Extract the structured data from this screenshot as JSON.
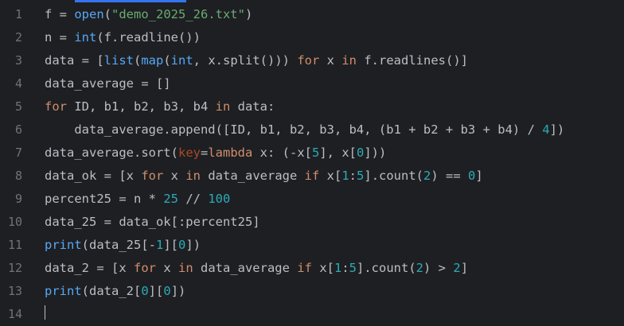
{
  "editor": {
    "colors": {
      "background": "#1e1f22",
      "line_number": "#6f737a",
      "default": "#bcbec4",
      "keyword": "#cf8e6d",
      "builtin": "#56a8f5",
      "string": "#6aab73",
      "number": "#2aacb8",
      "param": "#aa4926"
    },
    "lines": [
      {
        "number": "1",
        "tokens": [
          {
            "t": "f = ",
            "c": "default"
          },
          {
            "t": "open",
            "c": "builtin"
          },
          {
            "t": "(",
            "c": "default"
          },
          {
            "t": "\"demo_2025_26.txt\"",
            "c": "string"
          },
          {
            "t": ")",
            "c": "default"
          }
        ]
      },
      {
        "number": "2",
        "tokens": [
          {
            "t": "n = ",
            "c": "default"
          },
          {
            "t": "int",
            "c": "builtin"
          },
          {
            "t": "(f.readline())",
            "c": "default"
          }
        ]
      },
      {
        "number": "3",
        "tokens": [
          {
            "t": "data = [",
            "c": "default"
          },
          {
            "t": "list",
            "c": "builtin"
          },
          {
            "t": "(",
            "c": "default"
          },
          {
            "t": "map",
            "c": "builtin"
          },
          {
            "t": "(",
            "c": "default"
          },
          {
            "t": "int",
            "c": "builtin"
          },
          {
            "t": ", x.split())) ",
            "c": "default"
          },
          {
            "t": "for",
            "c": "keyword"
          },
          {
            "t": " x ",
            "c": "default"
          },
          {
            "t": "in",
            "c": "keyword"
          },
          {
            "t": " f.readlines()]",
            "c": "default"
          }
        ]
      },
      {
        "number": "4",
        "tokens": [
          {
            "t": "data_average = []",
            "c": "default"
          }
        ]
      },
      {
        "number": "5",
        "tokens": [
          {
            "t": "for",
            "c": "keyword"
          },
          {
            "t": " ID, b1, b2, b3, b4 ",
            "c": "default"
          },
          {
            "t": "in",
            "c": "keyword"
          },
          {
            "t": " data:",
            "c": "default"
          }
        ]
      },
      {
        "number": "6",
        "tokens": [
          {
            "t": "    data_average.append([ID, b1, b2, b3, b4, (b1 + b2 + b3 + b4) / ",
            "c": "default"
          },
          {
            "t": "4",
            "c": "number"
          },
          {
            "t": "])",
            "c": "default"
          }
        ]
      },
      {
        "number": "7",
        "tokens": [
          {
            "t": "data_average.sort(",
            "c": "default"
          },
          {
            "t": "key",
            "c": "param"
          },
          {
            "t": "=",
            "c": "default"
          },
          {
            "t": "lambda",
            "c": "keyword"
          },
          {
            "t": " x: (-x[",
            "c": "default"
          },
          {
            "t": "5",
            "c": "number"
          },
          {
            "t": "], x[",
            "c": "default"
          },
          {
            "t": "0",
            "c": "number"
          },
          {
            "t": "]))",
            "c": "default"
          }
        ]
      },
      {
        "number": "8",
        "tokens": [
          {
            "t": "data_ok = [x ",
            "c": "default"
          },
          {
            "t": "for",
            "c": "keyword"
          },
          {
            "t": " x ",
            "c": "default"
          },
          {
            "t": "in",
            "c": "keyword"
          },
          {
            "t": " data_average ",
            "c": "default"
          },
          {
            "t": "if",
            "c": "keyword"
          },
          {
            "t": " x[",
            "c": "default"
          },
          {
            "t": "1",
            "c": "number"
          },
          {
            "t": ":",
            "c": "default"
          },
          {
            "t": "5",
            "c": "number"
          },
          {
            "t": "].count(",
            "c": "default"
          },
          {
            "t": "2",
            "c": "number"
          },
          {
            "t": ") == ",
            "c": "default"
          },
          {
            "t": "0",
            "c": "number"
          },
          {
            "t": "]",
            "c": "default"
          }
        ]
      },
      {
        "number": "9",
        "tokens": [
          {
            "t": "percent25 = n * ",
            "c": "default"
          },
          {
            "t": "25",
            "c": "number"
          },
          {
            "t": " // ",
            "c": "default"
          },
          {
            "t": "100",
            "c": "number"
          }
        ]
      },
      {
        "number": "10",
        "tokens": [
          {
            "t": "data_25 = data_ok[:percent25]",
            "c": "default"
          }
        ]
      },
      {
        "number": "11",
        "tokens": [
          {
            "t": "print",
            "c": "builtin"
          },
          {
            "t": "(data_25[-",
            "c": "default"
          },
          {
            "t": "1",
            "c": "number"
          },
          {
            "t": "][",
            "c": "default"
          },
          {
            "t": "0",
            "c": "number"
          },
          {
            "t": "])",
            "c": "default"
          }
        ]
      },
      {
        "number": "12",
        "tokens": [
          {
            "t": "data_2 = [x ",
            "c": "default"
          },
          {
            "t": "for",
            "c": "keyword"
          },
          {
            "t": " x ",
            "c": "default"
          },
          {
            "t": "in",
            "c": "keyword"
          },
          {
            "t": " data_average ",
            "c": "default"
          },
          {
            "t": "if",
            "c": "keyword"
          },
          {
            "t": " x[",
            "c": "default"
          },
          {
            "t": "1",
            "c": "number"
          },
          {
            "t": ":",
            "c": "default"
          },
          {
            "t": "5",
            "c": "number"
          },
          {
            "t": "].count(",
            "c": "default"
          },
          {
            "t": "2",
            "c": "number"
          },
          {
            "t": ") > ",
            "c": "default"
          },
          {
            "t": "2",
            "c": "number"
          },
          {
            "t": "]",
            "c": "default"
          }
        ]
      },
      {
        "number": "13",
        "tokens": [
          {
            "t": "print",
            "c": "builtin"
          },
          {
            "t": "(data_2[",
            "c": "default"
          },
          {
            "t": "0",
            "c": "number"
          },
          {
            "t": "][",
            "c": "default"
          },
          {
            "t": "0",
            "c": "number"
          },
          {
            "t": "])",
            "c": "default"
          }
        ]
      },
      {
        "number": "14",
        "tokens": []
      }
    ]
  }
}
